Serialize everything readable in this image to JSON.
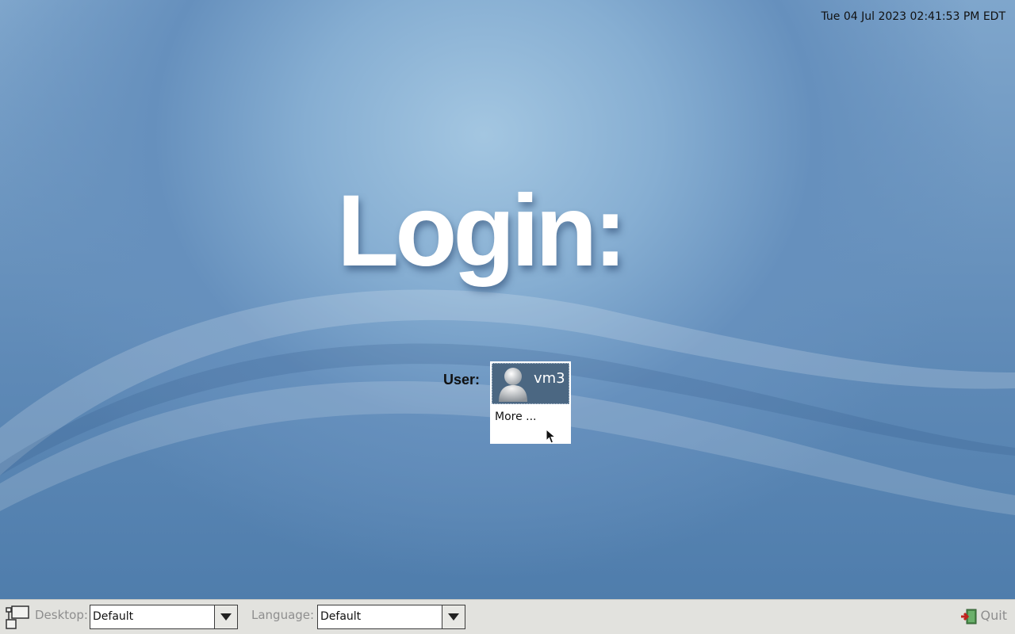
{
  "clock": "Tue 04 Jul 2023 02:41:53 PM EDT",
  "greeting": "Login:",
  "user_prompt": "User:",
  "users": [
    {
      "name": "vm3",
      "icon": "user-avatar-icon"
    }
  ],
  "more_option": "More ...",
  "taskbar": {
    "desktop_label": "Desktop:",
    "desktop_value": "Default",
    "language_label": "Language:",
    "language_value": "Default",
    "quit_label": "Quit"
  }
}
